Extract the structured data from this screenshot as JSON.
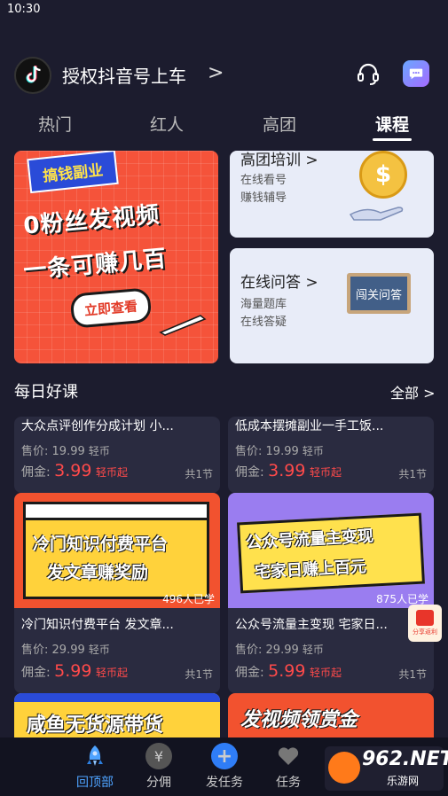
{
  "status": {
    "time": "10:30"
  },
  "header": {
    "title": "授权抖音号上车",
    "chevron": ">"
  },
  "tabs": [
    {
      "label": "热门"
    },
    {
      "label": "红人"
    },
    {
      "label": "高团"
    },
    {
      "label": "课程"
    }
  ],
  "active_tab": "课程",
  "banner": {
    "tag": "搞钱副业",
    "line1": "0粉丝发视频",
    "line2": "一条可赚几百",
    "button": "立即查看"
  },
  "side_cards": [
    {
      "title": "高团培训 >",
      "lines": [
        "在线看号",
        "赚钱辅导"
      ],
      "coin": "$"
    },
    {
      "title": "在线问答 >",
      "lines": [
        "海量题库",
        "在线答疑"
      ],
      "board": "闯关问答"
    }
  ],
  "section": {
    "title": "每日好课",
    "more": "全部 >"
  },
  "courses": [
    {
      "title": "大众点评创作分成计划 小...",
      "price_label": "售价:",
      "price": "19.99",
      "price_unit": "轻币",
      "commission_label": "佣金:",
      "commission": "3.99",
      "commission_unit": "轻币起",
      "sections": "共1节"
    },
    {
      "title": "低成本摆摊副业一手工饭...",
      "price_label": "售价:",
      "price": "19.99",
      "price_unit": "轻币",
      "commission_label": "佣金:",
      "commission": "3.99",
      "commission_unit": "轻币起",
      "sections": "共1节"
    },
    {
      "title": "冷门知识付费平台 发文章...",
      "thumb_line1": "冷门知识付费平台",
      "thumb_line2": "发文章赚奖励",
      "learners": "496人已学",
      "price_label": "售价:",
      "price": "29.99",
      "price_unit": "轻币",
      "commission_label": "佣金:",
      "commission": "5.99",
      "commission_unit": "轻币起",
      "sections": "共1节"
    },
    {
      "title": "公众号流量主变现 宅家日...",
      "thumb_line1": "公众号流量主变现",
      "thumb_line2": "宅家日赚上百元",
      "learners": "875人已学",
      "price_label": "售价:",
      "price": "29.99",
      "price_unit": "轻币",
      "commission_label": "佣金:",
      "commission": "5.99",
      "commission_unit": "轻币起",
      "sections": "共1节"
    }
  ],
  "partial_thumbs": [
    {
      "text": "咸鱼无货源带货"
    },
    {
      "text": "发视频领赏金"
    }
  ],
  "float_badge": {
    "label": "分享返利"
  },
  "tabbar": [
    {
      "label": "回顶部",
      "icon": "rocket-icon"
    },
    {
      "label": "分佣",
      "icon": "yen-icon"
    },
    {
      "label": "发任务",
      "icon": "plus-icon"
    },
    {
      "label": "任务",
      "icon": "heart-icon"
    }
  ],
  "watermark": {
    "num": "962.NET",
    "sub": "乐游网"
  },
  "colors": {
    "accent": "#4ea3ff",
    "commission": "#ff4a4a",
    "background": "#1c1c2e"
  }
}
